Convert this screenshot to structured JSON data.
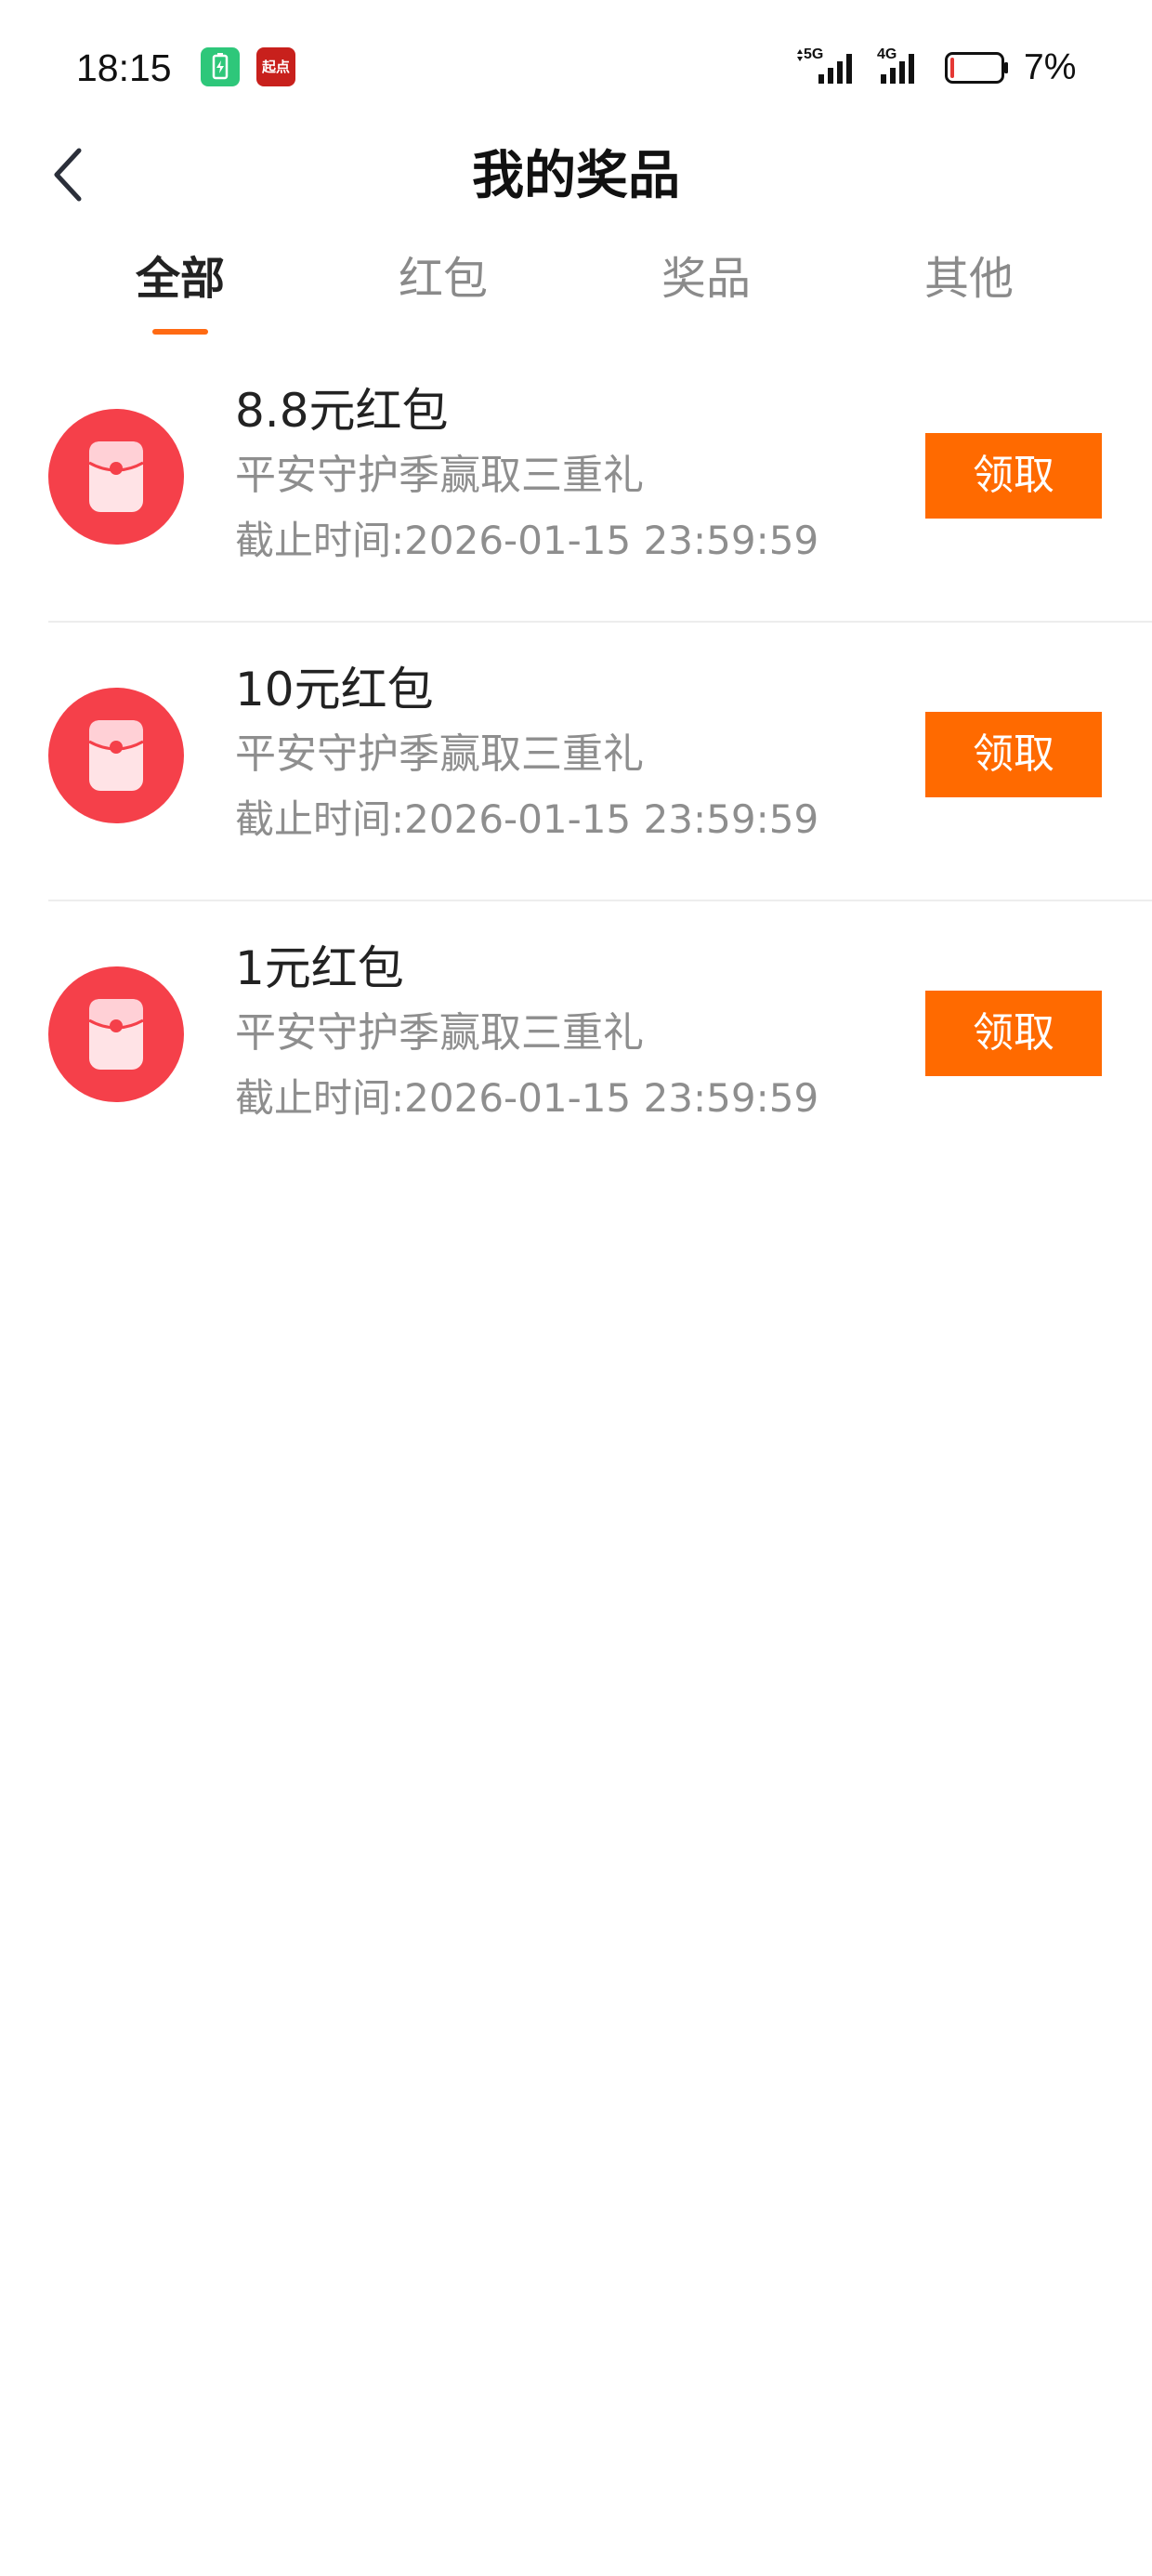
{
  "status_bar": {
    "time": "18:15",
    "notification_icons": [
      "battery-app-icon",
      "qidian-app-icon"
    ],
    "qidian_label": "起点",
    "network_5g": "5G",
    "network_4g": "4G",
    "battery_percent": "7%",
    "battery_level": 0.07
  },
  "header": {
    "title": "我的奖品"
  },
  "tabs": [
    {
      "label": "全部",
      "active": true
    },
    {
      "label": "红包",
      "active": false
    },
    {
      "label": "奖品",
      "active": false
    },
    {
      "label": "其他",
      "active": false
    }
  ],
  "prizes": [
    {
      "name": "8.8元红包",
      "description": "平安守护季赢取三重礼",
      "deadline": "截止时间:2026-01-15 23:59:59",
      "action_label": "领取"
    },
    {
      "name": "10元红包",
      "description": "平安守护季赢取三重礼",
      "deadline": "截止时间:2026-01-15 23:59:59",
      "action_label": "领取"
    },
    {
      "name": "1元红包",
      "description": "平安守护季赢取三重礼",
      "deadline": "截止时间:2026-01-15 23:59:59",
      "action_label": "领取"
    }
  ],
  "colors": {
    "accent": "#ff6a00",
    "tab_indicator": "#ff6a13",
    "red_packet": "#f5404a",
    "battery_low": "#e53935"
  }
}
